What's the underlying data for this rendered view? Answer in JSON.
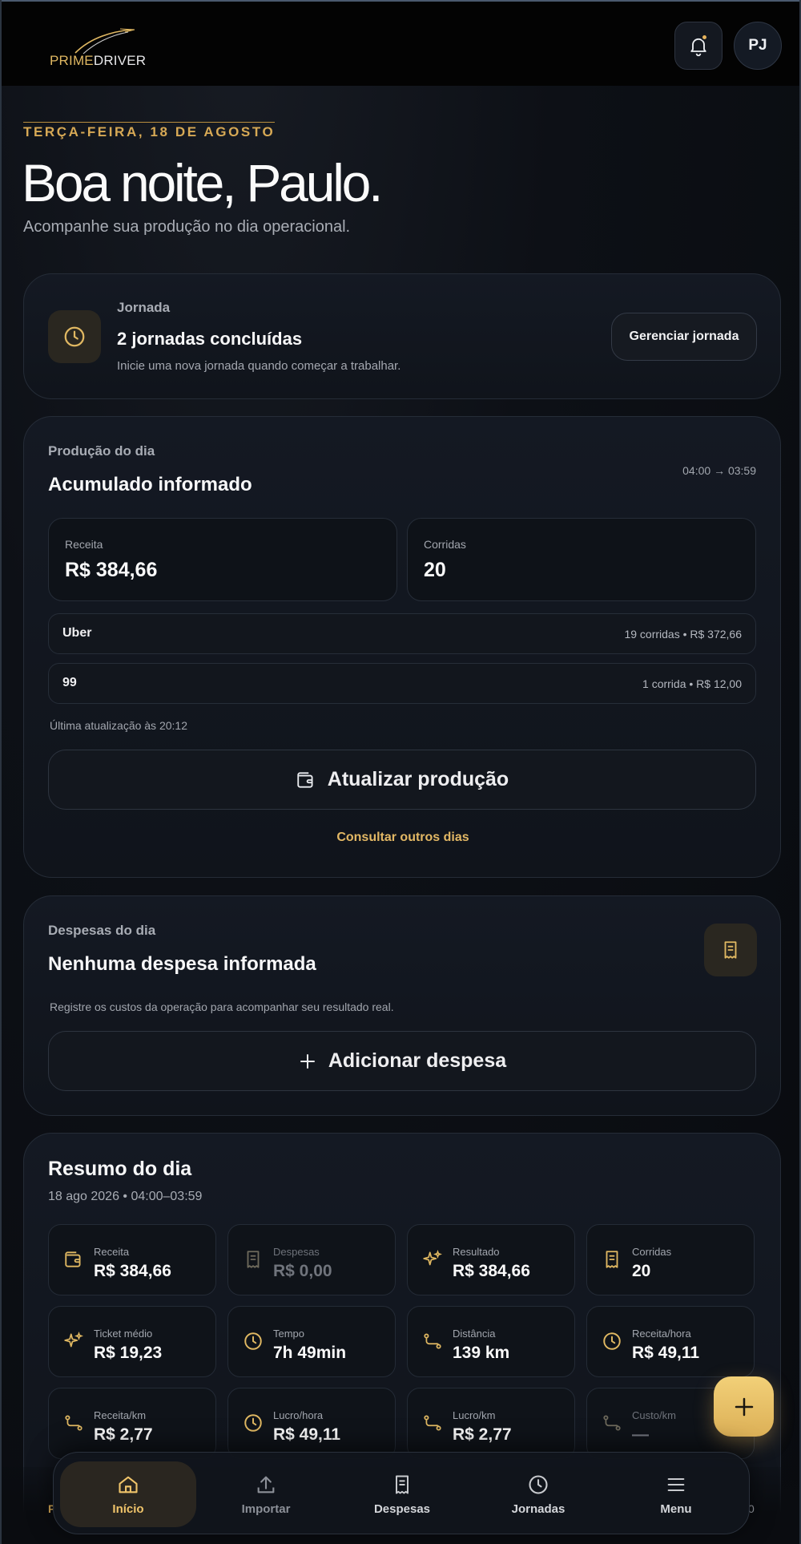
{
  "header": {
    "logo_prime": "PRIME",
    "logo_driver": "DRIVER",
    "avatar_initials": "PJ"
  },
  "greeting": {
    "date": "TERÇA-FEIRA, 18 DE AGOSTO",
    "title": "Boa noite, Paulo.",
    "subtitle": "Acompanhe sua produção no dia operacional."
  },
  "jornada": {
    "label": "Jornada",
    "title": "2 jornadas concluídas",
    "description": "Inicie uma nova jornada quando começar a trabalhar.",
    "manage_button": "Gerenciar jornada"
  },
  "producao": {
    "label": "Produção do dia",
    "title": "Acumulado informado",
    "window": "04:00 → 03:59",
    "receita_label": "Receita",
    "receita_value": "R$ 384,66",
    "corridas_label": "Corridas",
    "corridas_value": "20",
    "platforms": [
      {
        "name": "Uber",
        "info": "19 corridas • R$ 372,66"
      },
      {
        "name": "99",
        "info": "1 corrida • R$ 12,00"
      }
    ],
    "last_update": "Última atualização às 20:12",
    "update_button": "Atualizar produção",
    "other_days_link": "Consultar outros dias"
  },
  "despesas": {
    "label": "Despesas do dia",
    "title": "Nenhuma despesa informada",
    "description": "Registre os custos da operação para acompanhar seu resultado real.",
    "add_button": "Adicionar despesa"
  },
  "resumo": {
    "title": "Resumo do dia",
    "subtitle": "18 ago 2026 • 04:00–03:59",
    "tiles": [
      {
        "label": "Receita",
        "value": "R$ 384,66",
        "icon": "wallet-icon"
      },
      {
        "label": "Despesas",
        "value": "R$ 0,00",
        "icon": "receipt-icon"
      },
      {
        "label": "Resultado",
        "value": "R$ 384,66",
        "icon": "sparkles-icon"
      },
      {
        "label": "Corridas",
        "value": "20",
        "icon": "receipt-icon"
      },
      {
        "label": "Ticket médio",
        "value": "R$ 19,23",
        "icon": "sparkles-icon"
      },
      {
        "label": "Tempo",
        "value": "7h 49min",
        "icon": "clock-icon"
      },
      {
        "label": "Distância",
        "value": "139 km",
        "icon": "route-icon"
      },
      {
        "label": "Receita/hora",
        "value": "R$ 49,11",
        "icon": "clock-icon"
      },
      {
        "label": "Receita/km",
        "value": "R$ 2,77",
        "icon": "route-icon"
      },
      {
        "label": "Lucro/hora",
        "value": "R$ 49,11",
        "icon": "clock-icon"
      },
      {
        "label": "Lucro/km",
        "value": "R$ 2,77",
        "icon": "route-icon"
      },
      {
        "label": "Custo/km",
        "value": "—",
        "icon": "route-icon"
      }
    ],
    "under_nav_left": "P",
    "under_nav_right": "0"
  },
  "nav": {
    "items": [
      {
        "label": "Início",
        "icon": "home-icon",
        "active": true
      },
      {
        "label": "Importar",
        "icon": "upload-icon"
      },
      {
        "label": "Despesas",
        "icon": "receipt-icon"
      },
      {
        "label": "Jornadas",
        "icon": "clock-icon"
      },
      {
        "label": "Menu",
        "icon": "menu-icon"
      }
    ]
  },
  "colors": {
    "accent": "#e0b862",
    "background": "#0b0d12",
    "card": "#141923"
  }
}
